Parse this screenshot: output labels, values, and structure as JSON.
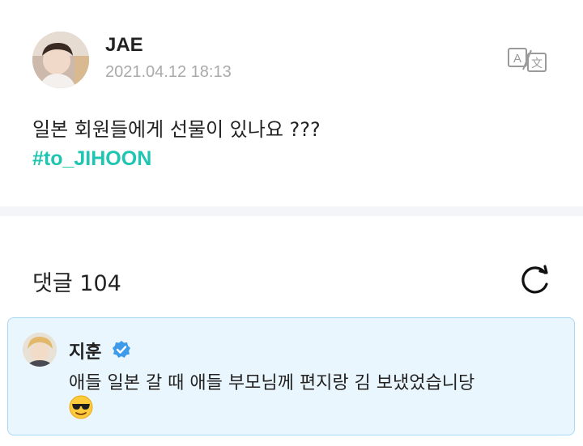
{
  "post": {
    "author": "JAE",
    "timestamp": "2021.04.12 18:13",
    "text": "일본 회원들에게 선물이 있나요 ???",
    "hashtag": "#to_JIHOON",
    "translate_icon": "translate-icon"
  },
  "comments": {
    "label": "댓글 104",
    "refresh_icon": "refresh-icon",
    "items": [
      {
        "author": "지훈",
        "verified": true,
        "text": "애들 일본 갈 때 애들 부모님께 편지랑 김 보냈었습니당",
        "emoji": "smiling-face-with-sunglasses"
      }
    ]
  },
  "colors": {
    "hashtag": "#1ec5b0",
    "comment_bg": "#eaf6fd",
    "comment_border": "#a8d8f2",
    "verified": "#3d9be9",
    "timestamp": "#aaaaaa"
  }
}
